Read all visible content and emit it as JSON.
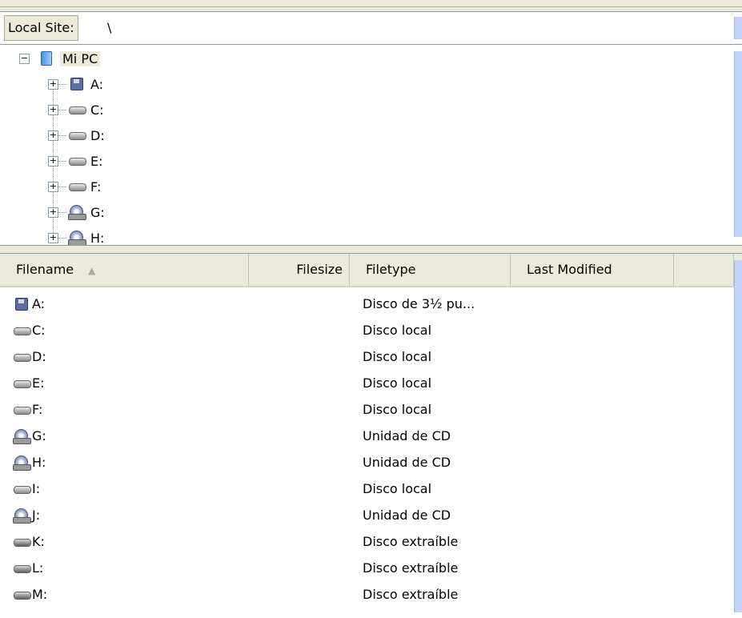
{
  "local_site": {
    "label": "Local Site:",
    "path": "\\"
  },
  "tree": {
    "root": {
      "label": "Mi PC",
      "toggle": "−",
      "icon": "computer-icon"
    },
    "children": [
      {
        "label": "A:",
        "toggle": "+",
        "icon": "floppy-drive-icon"
      },
      {
        "label": "C:",
        "toggle": "+",
        "icon": "hard-drive-icon"
      },
      {
        "label": "D:",
        "toggle": "+",
        "icon": "hard-drive-icon"
      },
      {
        "label": "E:",
        "toggle": "+",
        "icon": "hard-drive-icon"
      },
      {
        "label": "F:",
        "toggle": "+",
        "icon": "hard-drive-icon"
      },
      {
        "label": "G:",
        "toggle": "+",
        "icon": "cd-drive-icon"
      },
      {
        "label": "H:",
        "toggle": "+",
        "icon": "cd-drive-icon"
      }
    ]
  },
  "list": {
    "columns": {
      "filename": "Filename",
      "sort_indicator": "▲",
      "filesize": "Filesize",
      "filetype": "Filetype",
      "last_modified": "Last Modified"
    },
    "rows": [
      {
        "name": "A:",
        "type": "Disco de 3½ pu...",
        "icon": "floppy-drive-icon"
      },
      {
        "name": "C:",
        "type": "Disco local",
        "icon": "hard-drive-icon"
      },
      {
        "name": "D:",
        "type": "Disco local",
        "icon": "hard-drive-icon"
      },
      {
        "name": "E:",
        "type": "Disco local",
        "icon": "hard-drive-icon"
      },
      {
        "name": "F:",
        "type": "Disco local",
        "icon": "hard-drive-icon"
      },
      {
        "name": "G:",
        "type": "Unidad de CD",
        "icon": "cd-drive-icon"
      },
      {
        "name": "H:",
        "type": "Unidad de CD",
        "icon": "cd-drive-icon"
      },
      {
        "name": "I:",
        "type": "Disco local",
        "icon": "hard-drive-icon"
      },
      {
        "name": "J:",
        "type": "Unidad de CD",
        "icon": "cd-drive-icon"
      },
      {
        "name": "K:",
        "type": "Disco extraíble",
        "icon": "removable-drive-icon"
      },
      {
        "name": "L:",
        "type": "Disco extraíble",
        "icon": "removable-drive-icon"
      },
      {
        "name": "M:",
        "type": "Disco extraíble",
        "icon": "removable-drive-icon"
      }
    ]
  }
}
